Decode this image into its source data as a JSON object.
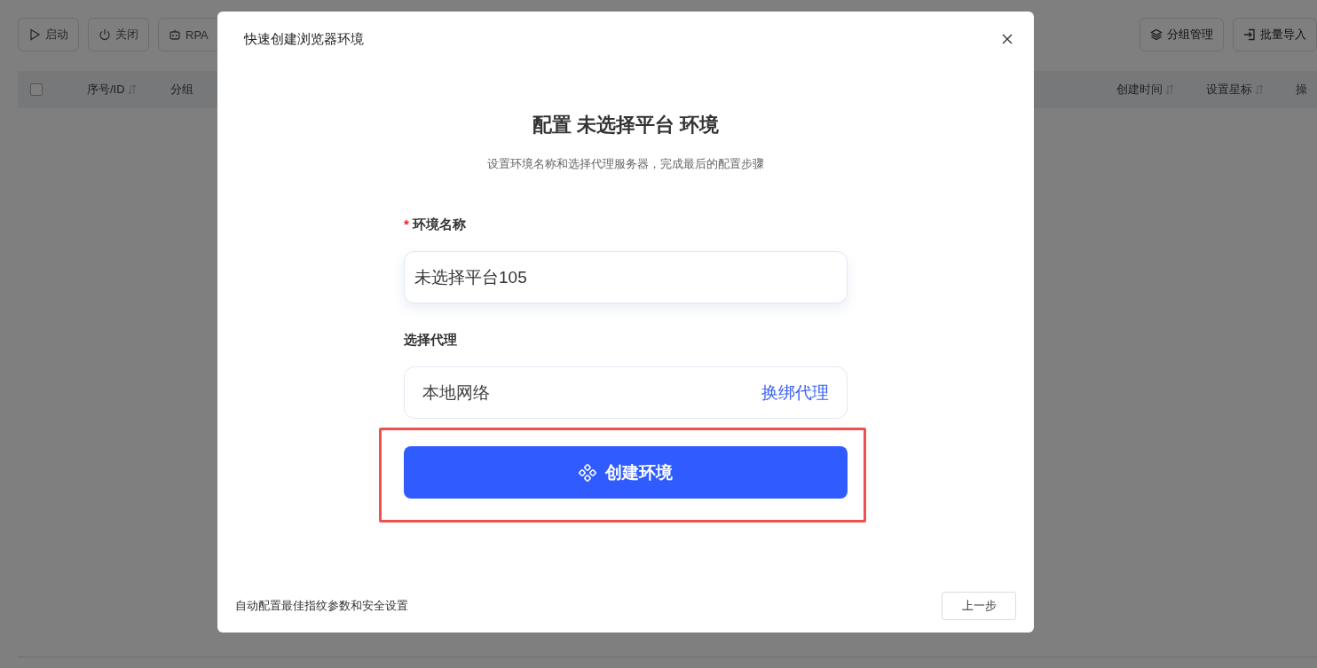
{
  "toolbar": {
    "left_buttons": [
      {
        "label": "启动"
      },
      {
        "label": "关闭"
      },
      {
        "label": "RPA"
      }
    ],
    "right_buttons": [
      {
        "label": "分组管理"
      },
      {
        "label": "批量导入"
      }
    ]
  },
  "table": {
    "select_all": {
      "checked": false
    },
    "left_columns": [
      {
        "label": "序号/ID",
        "sortable": true
      },
      {
        "label": "分组",
        "sortable": false
      }
    ],
    "right_columns": [
      {
        "label": "创建时间",
        "sortable": true
      },
      {
        "label": "设置星标",
        "sortable": true
      },
      {
        "label": "操",
        "sortable": false
      }
    ]
  },
  "dialog": {
    "title": "快速创建浏览器环境",
    "heading": "配置 未选择平台 环境",
    "subtitle": "设置环境名称和选择代理服务器，完成最后的配置步骤",
    "name_field": {
      "label": "环境名称",
      "required_mark": "*",
      "value": "未选择平台105"
    },
    "proxy_field": {
      "label": "选择代理",
      "value": "本地网络",
      "action": "换绑代理"
    },
    "create_button": {
      "label": "创建环境",
      "highlighted": true
    },
    "footer": {
      "note": "自动配置最佳指纹参数和安全设置",
      "back_button": "上一步"
    }
  }
}
